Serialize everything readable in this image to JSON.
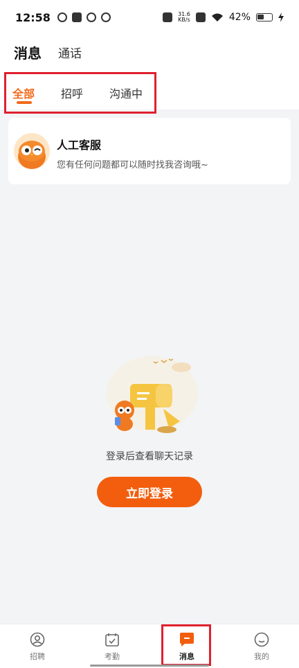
{
  "status_bar": {
    "time": "12:58",
    "net_speed_value": "31.6",
    "net_speed_unit": "KB/s",
    "battery_percent": "42%"
  },
  "header": {
    "title": "消息",
    "secondary_tab": "通话"
  },
  "sub_tabs": {
    "items": [
      {
        "label": "全部",
        "active": true
      },
      {
        "label": "招呼",
        "active": false
      },
      {
        "label": "沟通中",
        "active": false
      }
    ]
  },
  "service_card": {
    "title": "人工客服",
    "subtitle": "您有任何问题都可以随时找我咨询哦~"
  },
  "empty_state": {
    "message": "登录后查看聊天记录",
    "button": "立即登录"
  },
  "bottom_nav": {
    "items": [
      {
        "label": "招聘",
        "icon": "person-icon"
      },
      {
        "label": "考勤",
        "icon": "calendar-check-icon"
      },
      {
        "label": "消息",
        "icon": "message-icon",
        "active": true
      },
      {
        "label": "我的",
        "icon": "smiley-icon"
      }
    ]
  },
  "colors": {
    "accent": "#f26a1b",
    "button": "#f25e0e",
    "highlight_border": "#e0202e"
  }
}
